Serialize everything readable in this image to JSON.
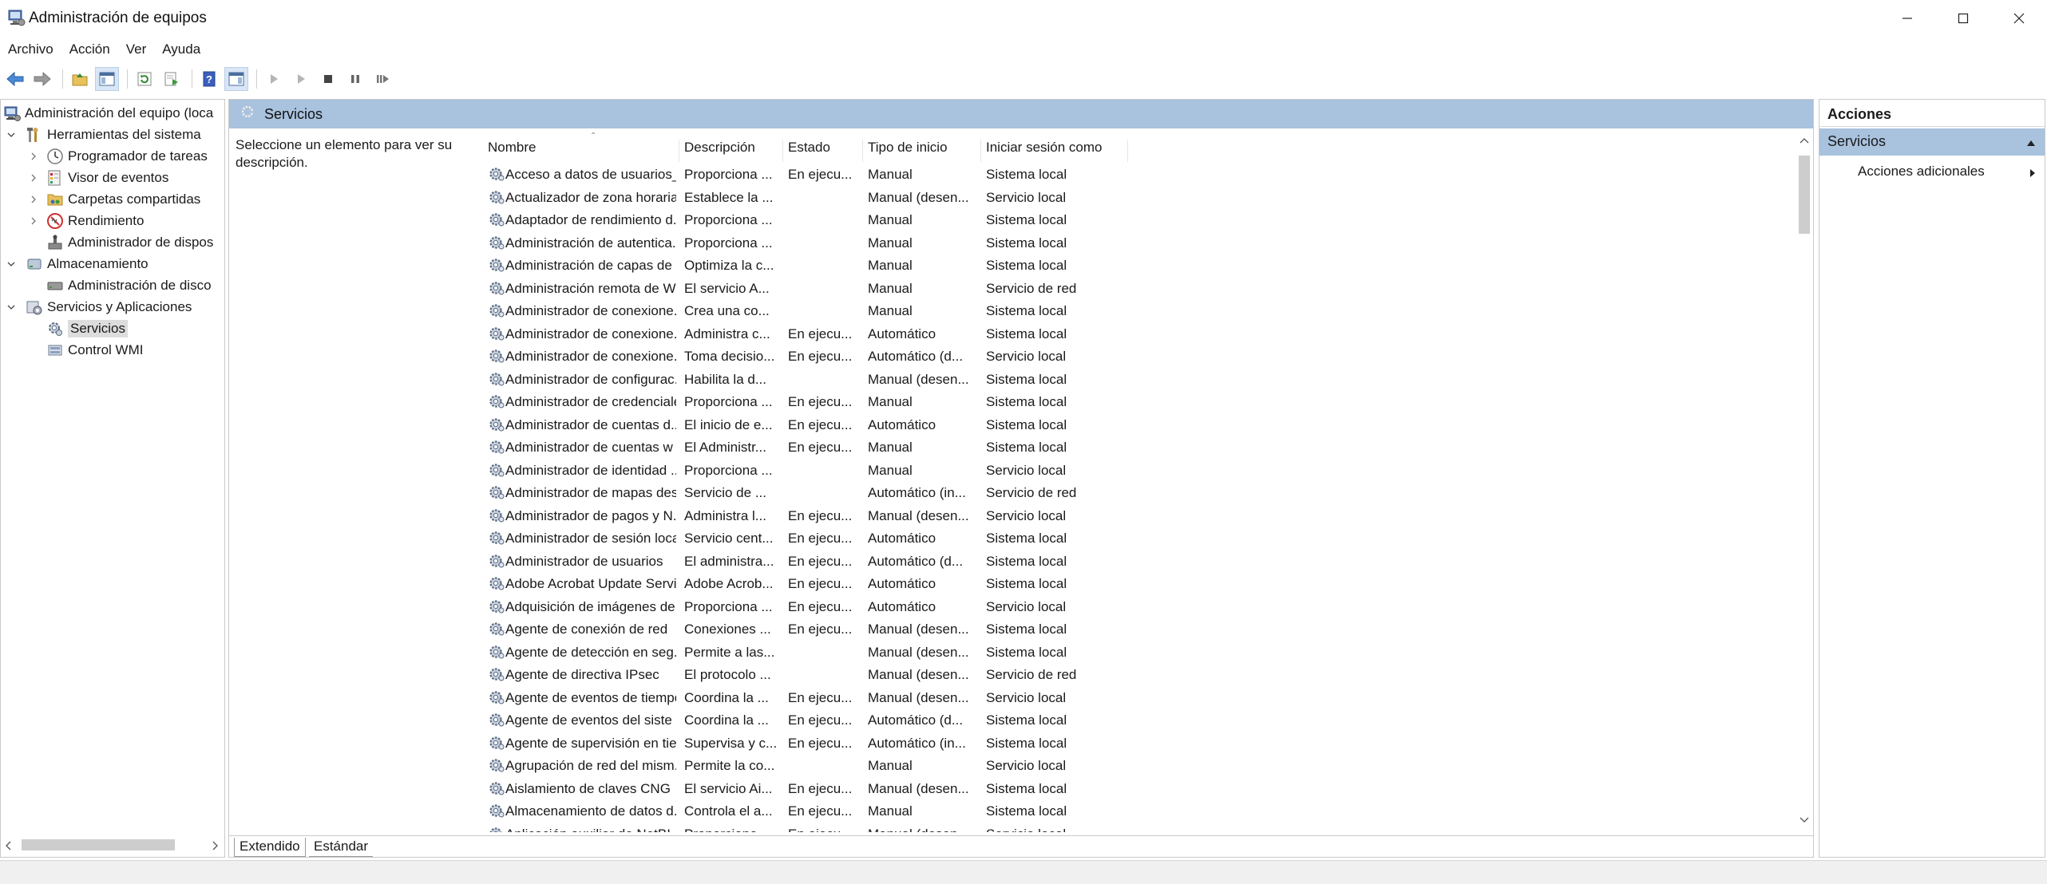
{
  "window": {
    "title": "Administración de equipos"
  },
  "menu": [
    "Archivo",
    "Acción",
    "Ver",
    "Ayuda"
  ],
  "tree": {
    "items": [
      {
        "label": "Administración del equipo (loca",
        "level": 0,
        "expander": "",
        "icon": "computer-icon"
      },
      {
        "label": "Herramientas del sistema",
        "level": 1,
        "expander": "down",
        "icon": "tools-icon"
      },
      {
        "label": "Programador de tareas",
        "level": 2,
        "expander": "right",
        "icon": "clock-icon"
      },
      {
        "label": "Visor de eventos",
        "level": 2,
        "expander": "right",
        "icon": "event-viewer-icon"
      },
      {
        "label": "Carpetas compartidas",
        "level": 2,
        "expander": "right",
        "icon": "shared-folder-icon"
      },
      {
        "label": "Rendimiento",
        "level": 2,
        "expander": "right",
        "icon": "performance-icon"
      },
      {
        "label": "Administrador de dispos",
        "level": 2,
        "expander": "",
        "icon": "device-manager-icon"
      },
      {
        "label": "Almacenamiento",
        "level": 1,
        "expander": "down",
        "icon": "storage-icon"
      },
      {
        "label": "Administración de disco",
        "level": 2,
        "expander": "",
        "icon": "disk-icon"
      },
      {
        "label": "Servicios y Aplicaciones",
        "level": 1,
        "expander": "down",
        "icon": "services-apps-icon"
      },
      {
        "label": "Servicios",
        "level": 2,
        "expander": "",
        "icon": "services-icon",
        "selected": true
      },
      {
        "label": "Control WMI",
        "level": 2,
        "expander": "",
        "icon": "wmi-icon"
      }
    ]
  },
  "center": {
    "header": "Servicios",
    "description_prompt": "Seleccione un elemento para ver su descripción.",
    "columns": [
      "Nombre",
      "Descripción",
      "Estado",
      "Tipo de inicio",
      "Iniciar sesión como"
    ],
    "rows": [
      [
        "Acceso a datos de usuarios_...",
        "Proporciona ...",
        "En ejecu...",
        "Manual",
        "Sistema local"
      ],
      [
        "Actualizador de zona horaria...",
        "Establece la ...",
        "",
        "Manual (desen...",
        "Servicio local"
      ],
      [
        "Adaptador de rendimiento d...",
        "Proporciona ...",
        "",
        "Manual",
        "Sistema local"
      ],
      [
        "Administración de autentica...",
        "Proporciona ...",
        "",
        "Manual",
        "Sistema local"
      ],
      [
        "Administración de capas de ...",
        "Optimiza la c...",
        "",
        "Manual",
        "Sistema local"
      ],
      [
        "Administración remota de W...",
        "El servicio A...",
        "",
        "Manual",
        "Servicio de red"
      ],
      [
        "Administrador de conexione...",
        "Crea una co...",
        "",
        "Manual",
        "Sistema local"
      ],
      [
        "Administrador de conexione...",
        "Administra c...",
        "En ejecu...",
        "Automático",
        "Sistema local"
      ],
      [
        "Administrador de conexione...",
        "Toma decisio...",
        "En ejecu...",
        "Automático (d...",
        "Servicio local"
      ],
      [
        "Administrador de configurac...",
        "Habilita la d...",
        "",
        "Manual (desen...",
        "Sistema local"
      ],
      [
        "Administrador de credenciales",
        "Proporciona ...",
        "En ejecu...",
        "Manual",
        "Sistema local"
      ],
      [
        "Administrador de cuentas d...",
        "El inicio de e...",
        "En ejecu...",
        "Automático",
        "Sistema local"
      ],
      [
        "Administrador de cuentas w",
        "El Administr...",
        "En ejecu...",
        "Manual",
        "Sistema local"
      ],
      [
        "Administrador de identidad ...",
        "Proporciona ...",
        "",
        "Manual",
        "Servicio local"
      ],
      [
        "Administrador de mapas des...",
        "Servicio de ...",
        "",
        "Automático (in...",
        "Servicio de red"
      ],
      [
        "Administrador de pagos y N...",
        "Administra l...",
        "En ejecu...",
        "Manual (desen...",
        "Servicio local"
      ],
      [
        "Administrador de sesión local",
        "Servicio cent...",
        "En ejecu...",
        "Automático",
        "Sistema local"
      ],
      [
        "Administrador de usuarios",
        "El administra...",
        "En ejecu...",
        "Automático (d...",
        "Sistema local"
      ],
      [
        "Adobe Acrobat Update Servi",
        "Adobe Acrob...",
        "En ejecu...",
        "Automático",
        "Sistema local"
      ],
      [
        "Adquisición de imágenes de...",
        "Proporciona ...",
        "En ejecu...",
        "Automático",
        "Servicio local"
      ],
      [
        "Agente de conexión de red",
        "Conexiones ...",
        "En ejecu...",
        "Manual (desen...",
        "Sistema local"
      ],
      [
        "Agente de detección en seg...",
        "Permite a las...",
        "",
        "Manual (desen...",
        "Sistema local"
      ],
      [
        "Agente de directiva IPsec",
        "El protocolo ...",
        "",
        "Manual (desen...",
        "Servicio de red"
      ],
      [
        "Agente de eventos de tiempo",
        "Coordina la ...",
        "En ejecu...",
        "Manual (desen...",
        "Servicio local"
      ],
      [
        "Agente de eventos del siste",
        "Coordina la ...",
        "En ejecu...",
        "Automático (d...",
        "Sistema local"
      ],
      [
        "Agente de supervisión en tie...",
        "Supervisa y c...",
        "En ejecu...",
        "Automático (in...",
        "Sistema local"
      ],
      [
        "Agrupación de red del mism...",
        "Permite la co...",
        "",
        "Manual",
        "Servicio local"
      ],
      [
        "Aislamiento de claves CNG",
        "El servicio Ai...",
        "En ejecu...",
        "Manual (desen...",
        "Sistema local"
      ],
      [
        "Almacenamiento de datos d...",
        "Controla el a...",
        "En ejecu...",
        "Manual",
        "Sistema local"
      ],
      [
        "Aplicación auxiliar de NetBI...",
        "Proporciona ...",
        "En ejecu...",
        "Manual (desen...",
        "Servicio local"
      ]
    ],
    "tabs": [
      "Extendido",
      "Estándar"
    ]
  },
  "actions": {
    "title": "Acciones",
    "section": "Servicios",
    "item": "Acciones adicionales"
  },
  "colors": {
    "header_band": "#a9c2de",
    "selection": "#dddddd"
  }
}
